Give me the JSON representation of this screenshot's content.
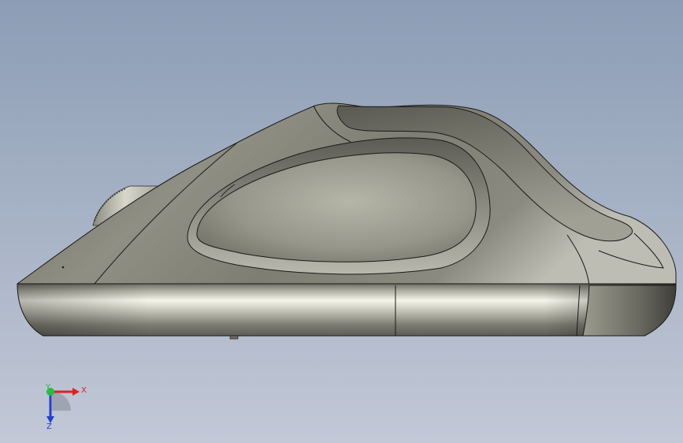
{
  "viewport": {
    "background_top": "#8c9db5",
    "background_bottom": "#c2c8d6",
    "model": {
      "name": "mouse-side-view",
      "body_color": "#8d8d80",
      "highlight_color": "#f4f4ea",
      "shadow_color": "#4a4a45",
      "edge_color": "#1a1a1a"
    },
    "triad": {
      "x_label": "X",
      "y_label": "Y",
      "z_label": "Z",
      "x_color": "#e02020",
      "y_color": "#20c040",
      "z_color": "#2040d0"
    }
  }
}
